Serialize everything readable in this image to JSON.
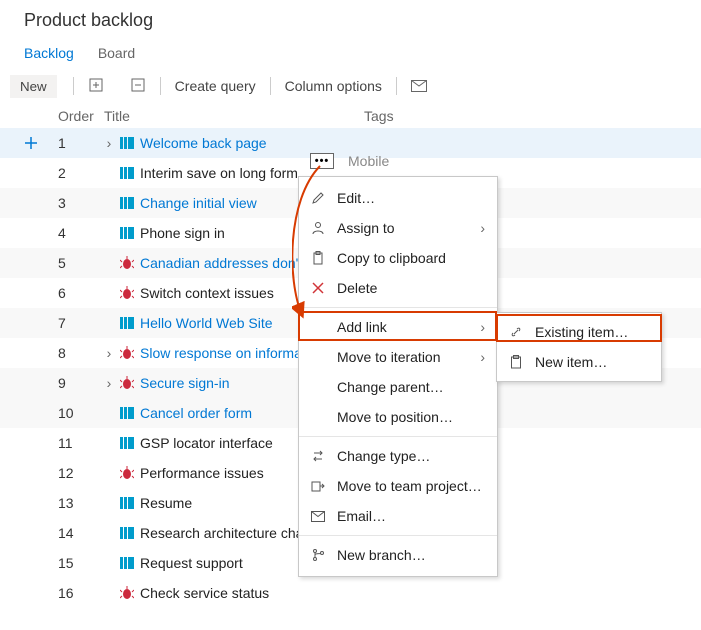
{
  "page_title": "Product backlog",
  "tabs": {
    "backlog": "Backlog",
    "board": "Board"
  },
  "toolbar": {
    "new": "New",
    "create_query": "Create query",
    "column_options": "Column options"
  },
  "columns": {
    "order": "Order",
    "title": "Title",
    "tags": "Tags"
  },
  "rows": [
    {
      "order": 1,
      "type": "pbi",
      "title": "Welcome back page",
      "expand": true,
      "link": true,
      "tags": "Mobile",
      "selected": true
    },
    {
      "order": 2,
      "type": "pbi",
      "title": "Interim save on long form",
      "expand": false,
      "link": false
    },
    {
      "order": 3,
      "type": "pbi",
      "title": "Change initial view",
      "expand": false,
      "link": true,
      "stripe": true
    },
    {
      "order": 4,
      "type": "pbi",
      "title": "Phone sign in",
      "expand": false,
      "link": false
    },
    {
      "order": 5,
      "type": "bug",
      "title": "Canadian addresses don't di…",
      "expand": false,
      "link": true,
      "stripe": true
    },
    {
      "order": 6,
      "type": "bug",
      "title": "Switch context issues",
      "expand": false,
      "link": false
    },
    {
      "order": 7,
      "type": "pbi",
      "title": "Hello World Web Site",
      "expand": false,
      "link": true,
      "stripe": true
    },
    {
      "order": 8,
      "type": "bug",
      "title": "Slow response on informati…",
      "expand": true,
      "link": true
    },
    {
      "order": 9,
      "type": "bug",
      "title": "Secure sign-in",
      "expand": true,
      "link": true,
      "stripe": true
    },
    {
      "order": 10,
      "type": "pbi",
      "title": "Cancel order form",
      "expand": false,
      "link": true,
      "stripe": true
    },
    {
      "order": 11,
      "type": "pbi",
      "title": "GSP locator interface",
      "expand": false,
      "link": false
    },
    {
      "order": 12,
      "type": "bug",
      "title": "Performance issues",
      "expand": false,
      "link": false
    },
    {
      "order": 13,
      "type": "pbi",
      "title": "Resume",
      "expand": false,
      "link": false
    },
    {
      "order": 14,
      "type": "pbi",
      "title": "Research architecture changes",
      "expand": false,
      "link": false
    },
    {
      "order": 15,
      "type": "pbi",
      "title": "Request support",
      "expand": false,
      "link": false
    },
    {
      "order": 16,
      "type": "bug",
      "title": "Check service status",
      "expand": false,
      "link": false
    }
  ],
  "context_menu": {
    "edit": "Edit…",
    "assign_to": "Assign to",
    "copy": "Copy to clipboard",
    "delete": "Delete",
    "add_link": "Add link",
    "move_iter": "Move to iteration",
    "change_parent": "Change parent…",
    "move_pos": "Move to position…",
    "change_type": "Change type…",
    "move_team": "Move to team project…",
    "email": "Email…",
    "new_branch": "New branch…"
  },
  "submenu": {
    "existing": "Existing item…",
    "new_item": "New item…"
  },
  "ellipsis": "•••"
}
